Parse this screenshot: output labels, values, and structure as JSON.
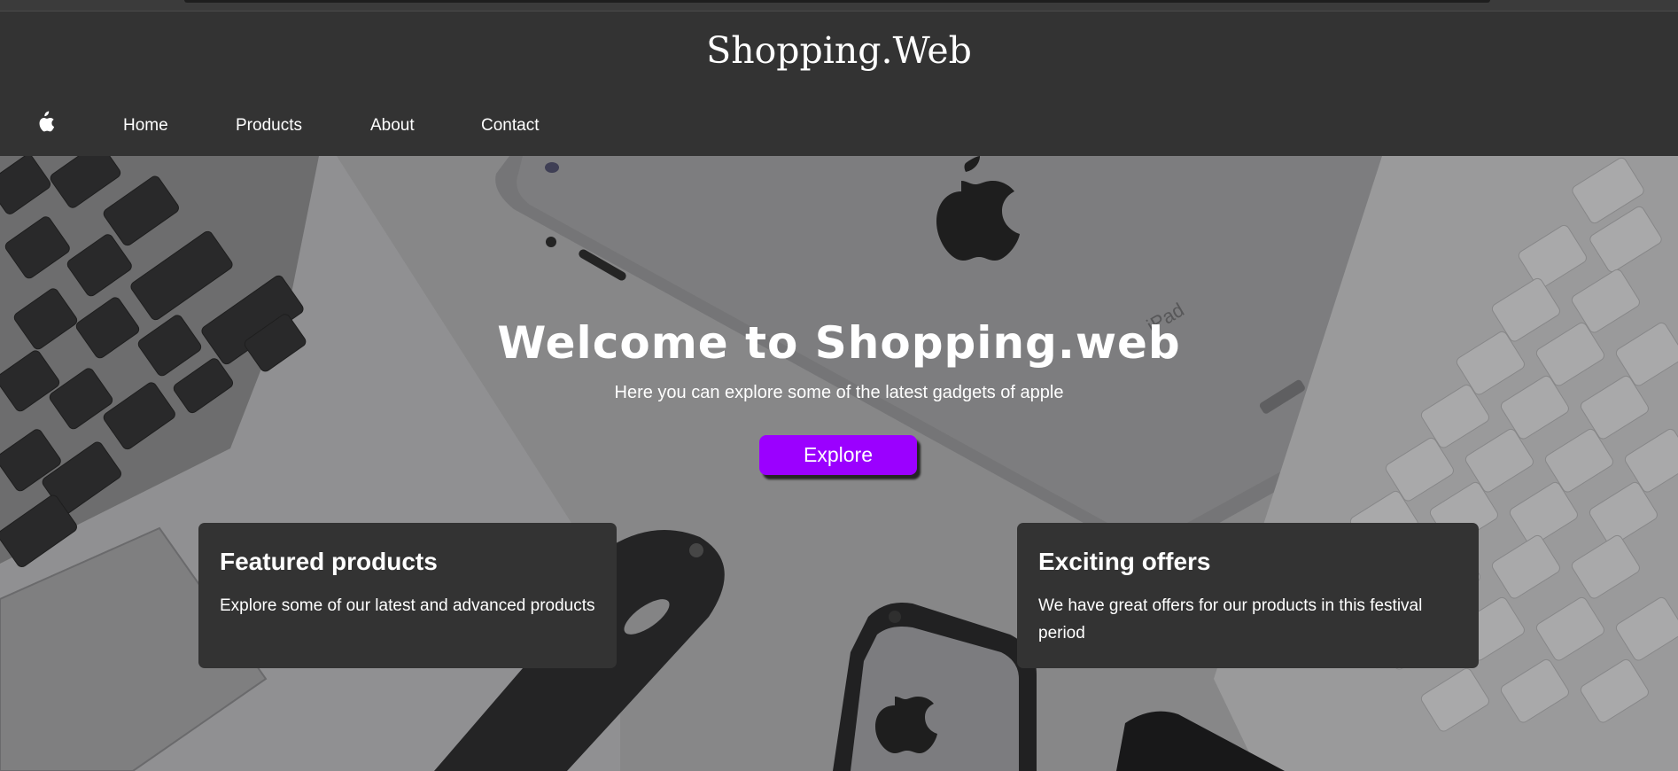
{
  "brand": {
    "title": "Shopping.Web"
  },
  "nav": {
    "logo": "apple-icon",
    "items": [
      {
        "label": "Home"
      },
      {
        "label": "Products"
      },
      {
        "label": "About"
      },
      {
        "label": "Contact"
      }
    ]
  },
  "hero": {
    "title": "Welcome to Shopping.web",
    "subtitle": "Here you can explore some of the latest gadgets of apple",
    "cta_label": "Explore",
    "background": "apple-gadgets-photo"
  },
  "cards": [
    {
      "title": "Featured products",
      "text": "Explore some of our latest and advanced products"
    },
    {
      "title": "Exciting offers",
      "text": "We have great offers for our products in this festival period"
    }
  ],
  "colors": {
    "header_bg": "#333333",
    "accent": "#9b00ff",
    "card_bg": "#333333",
    "text": "#ffffff"
  }
}
